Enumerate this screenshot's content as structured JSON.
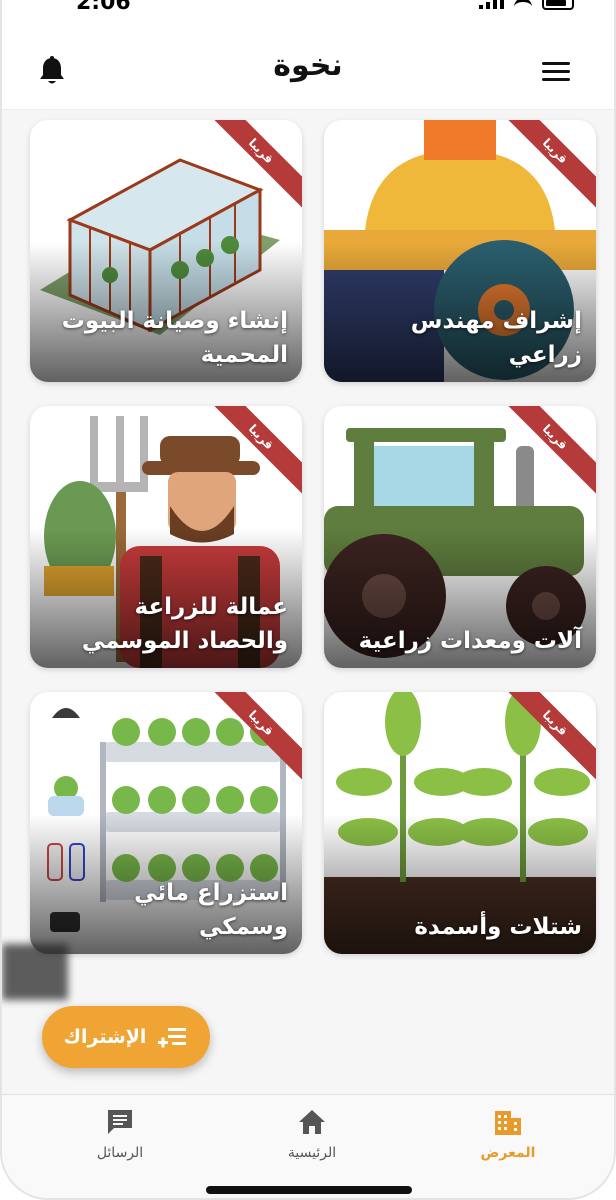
{
  "status": {
    "time": "2:06"
  },
  "header": {
    "title": "نخوة"
  },
  "badge": "قريبا",
  "cards": [
    {
      "label": "إشراف مهندس زراعي"
    },
    {
      "label": "إنشاء وصيانة البيوت المحمية"
    },
    {
      "label": "آلات ومعدات زراعية"
    },
    {
      "label": "عمالة للزراعة والحصاد الموسمي"
    },
    {
      "label": "شتلات وأسمدة"
    },
    {
      "label": "استزراع مائي وسمكي"
    }
  ],
  "subscribe": {
    "label": "الإشتراك"
  },
  "nav": {
    "gallery": "المعرض",
    "home": "الرئيسية",
    "messages": "الرسائل"
  },
  "colors": {
    "accent": "#f0a434",
    "ribbon": "#b53a3a",
    "active_nav": "#e79b2b"
  }
}
